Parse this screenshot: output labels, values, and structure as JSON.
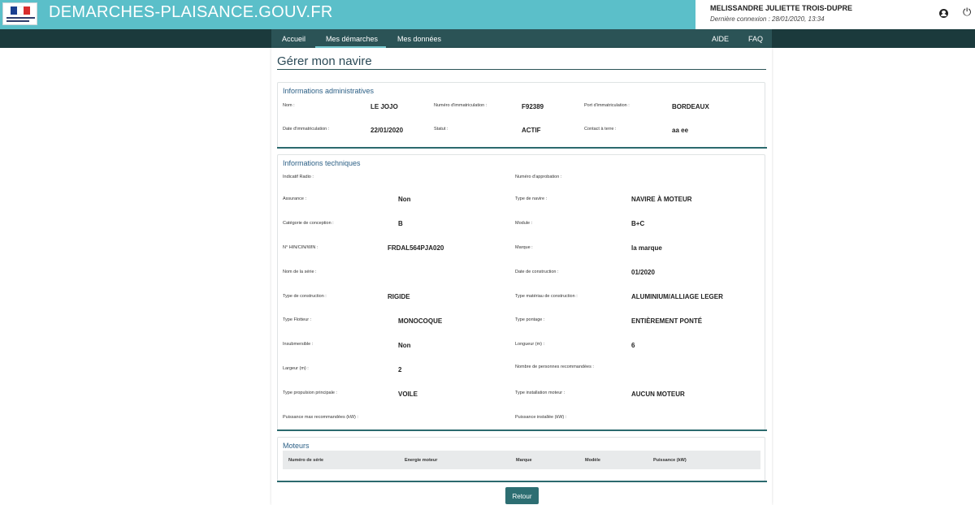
{
  "header": {
    "site_title": "DEMARCHES-PLAISANCE.GOUV.FR",
    "logo_text": "Ministère de la Transition écologique",
    "user_name": "MELISSANDRE JULIETTE TROIS-DUPRE",
    "last_login": "Dernière connexion : 28/01/2020, 13:34"
  },
  "nav": {
    "items": [
      "Accueil",
      "Mes démarches",
      "Mes données"
    ],
    "active": "Mes démarches",
    "right_items": [
      "AIDE",
      "FAQ"
    ]
  },
  "page": {
    "title": "Gérer mon navire"
  },
  "admin": {
    "title": "Informations administratives",
    "fields": [
      {
        "label": "Nom :",
        "value": "LE JOJO"
      },
      {
        "label": "Numéro d'immatriculation :",
        "value": "F92389"
      },
      {
        "label": "Port d'immatriculation :",
        "value": "BORDEAUX"
      },
      {
        "label": "Date d'immatriculation :",
        "value": "22/01/2020"
      },
      {
        "label": "Statut :",
        "value": "ACTIF"
      },
      {
        "label": "Contact à terre :",
        "value": "aa ee"
      }
    ]
  },
  "tech": {
    "title": "Informations techniques",
    "left": [
      {
        "label": "Indicatif Radio :",
        "value": ""
      },
      {
        "label": "Assurance :",
        "value": "Non"
      },
      {
        "label": "Catégorie de conception :",
        "value": "B"
      },
      {
        "label": "N° HIN/CIN/WIN :",
        "value": "FRDAL564PJA020"
      },
      {
        "label": "Nom de la série :",
        "value": ""
      },
      {
        "label": "Type de construction :",
        "value": "RIGIDE"
      },
      {
        "label": "Type Flotteur :",
        "value": "MONOCOQUE"
      },
      {
        "label": "Insubmersible :",
        "value": "Non"
      },
      {
        "label": "Largeur (m) :",
        "value": "2"
      },
      {
        "label": "Type propulsion principale :",
        "value": "VOILE"
      },
      {
        "label": "Puissance max recommandées (kW) :",
        "value": ""
      }
    ],
    "right": [
      {
        "label": "Numéro d'approbation :",
        "value": ""
      },
      {
        "label": "Type de navire :",
        "value": "NAVIRE À MOTEUR"
      },
      {
        "label": "Module :",
        "value": "B+C"
      },
      {
        "label": "Marque :",
        "value": "la marque"
      },
      {
        "label": "Date de construction :",
        "value": "01/2020"
      },
      {
        "label": "Type matériau de construction :",
        "value": "ALUMINIUM/ALLIAGE LEGER"
      },
      {
        "label": "Type pontage :",
        "value": "ENTIÈREMENT PONTÉ"
      },
      {
        "label": "Longueur (m) :",
        "value": "6"
      },
      {
        "label": "Nombre de personnes recommandées :",
        "value": ""
      },
      {
        "label": "Type installation moteur :",
        "value": "AUCUN MOTEUR"
      },
      {
        "label": "Puissance installée (kW) :",
        "value": ""
      }
    ]
  },
  "motors": {
    "title": "Moteurs",
    "columns": [
      "Numéro de série",
      "Energie moteur",
      "Marque",
      "Modèle",
      "Puissance (kW)"
    ]
  },
  "actions": {
    "back_label": "Retour"
  },
  "colors": {
    "header_teal": "#5bbfc9",
    "nav_dark": "#1b3a3c",
    "nav_inner": "#2b5356",
    "accent": "#2d6e72"
  }
}
